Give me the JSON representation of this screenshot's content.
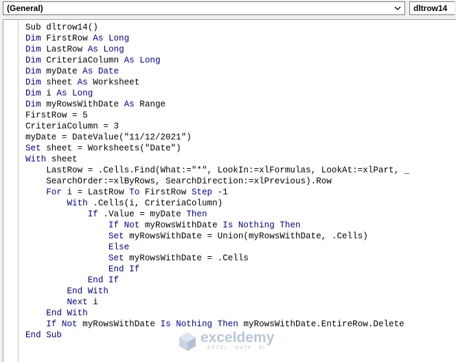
{
  "toolbar": {
    "object_box": "(General)",
    "procedure_box": "dltrow14"
  },
  "code_lines": [
    [
      {
        "t": "Sub dltrow14()",
        "k": false
      }
    ],
    [
      {
        "t": "Dim",
        "k": true
      },
      {
        "t": " FirstRow ",
        "k": false
      },
      {
        "t": "As Long",
        "k": true
      }
    ],
    [
      {
        "t": "Dim",
        "k": true
      },
      {
        "t": " LastRow ",
        "k": false
      },
      {
        "t": "As Long",
        "k": true
      }
    ],
    [
      {
        "t": "Dim",
        "k": true
      },
      {
        "t": " CriteriaColumn ",
        "k": false
      },
      {
        "t": "As Long",
        "k": true
      }
    ],
    [
      {
        "t": "Dim",
        "k": true
      },
      {
        "t": " myDate ",
        "k": false
      },
      {
        "t": "As Date",
        "k": true
      }
    ],
    [
      {
        "t": "Dim",
        "k": true
      },
      {
        "t": " sheet ",
        "k": false
      },
      {
        "t": "As",
        "k": true
      },
      {
        "t": " Worksheet",
        "k": false
      }
    ],
    [
      {
        "t": "Dim",
        "k": true
      },
      {
        "t": " i ",
        "k": false
      },
      {
        "t": "As Long",
        "k": true
      }
    ],
    [
      {
        "t": "Dim",
        "k": true
      },
      {
        "t": " myRowsWithDate ",
        "k": false
      },
      {
        "t": "As",
        "k": true
      },
      {
        "t": " Range",
        "k": false
      }
    ],
    [
      {
        "t": "FirstRow = 5",
        "k": false
      }
    ],
    [
      {
        "t": "CriteriaColumn = 3",
        "k": false
      }
    ],
    [
      {
        "t": "myDate = DateValue(\"11/12/2021\")",
        "k": false
      }
    ],
    [
      {
        "t": "Set",
        "k": true
      },
      {
        "t": " sheet = Worksheets(\"Date\")",
        "k": false
      }
    ],
    [
      {
        "t": "With",
        "k": true
      },
      {
        "t": " sheet",
        "k": false
      }
    ],
    [
      {
        "t": "    LastRow = .Cells.Find(What:=\"*\", LookIn:=xlFormulas, LookAt:=xlPart, _",
        "k": false
      }
    ],
    [
      {
        "t": "    SearchOrder:=xlByRows, SearchDirection:=xlPrevious).Row",
        "k": false
      }
    ],
    [
      {
        "t": "    ",
        "k": false
      },
      {
        "t": "For",
        "k": true
      },
      {
        "t": " i = LastRow ",
        "k": false
      },
      {
        "t": "To",
        "k": true
      },
      {
        "t": " FirstRow ",
        "k": false
      },
      {
        "t": "Step",
        "k": true
      },
      {
        "t": " -1",
        "k": false
      }
    ],
    [
      {
        "t": "        ",
        "k": false
      },
      {
        "t": "With",
        "k": true
      },
      {
        "t": " .Cells(i, CriteriaColumn)",
        "k": false
      }
    ],
    [
      {
        "t": "            ",
        "k": false
      },
      {
        "t": "If",
        "k": true
      },
      {
        "t": " .Value = myDate ",
        "k": false
      },
      {
        "t": "Then",
        "k": true
      }
    ],
    [
      {
        "t": "                ",
        "k": false
      },
      {
        "t": "If Not",
        "k": true
      },
      {
        "t": " myRowsWithDate ",
        "k": false
      },
      {
        "t": "Is Nothing Then",
        "k": true
      }
    ],
    [
      {
        "t": "                ",
        "k": false
      },
      {
        "t": "Set",
        "k": true
      },
      {
        "t": " myRowsWithDate = Union(myRowsWithDate, .Cells)",
        "k": false
      }
    ],
    [
      {
        "t": "                ",
        "k": false
      },
      {
        "t": "Else",
        "k": true
      }
    ],
    [
      {
        "t": "                ",
        "k": false
      },
      {
        "t": "Set",
        "k": true
      },
      {
        "t": " myRowsWithDate = .Cells",
        "k": false
      }
    ],
    [
      {
        "t": "                ",
        "k": false
      },
      {
        "t": "End If",
        "k": true
      }
    ],
    [
      {
        "t": "            ",
        "k": false
      },
      {
        "t": "End If",
        "k": true
      }
    ],
    [
      {
        "t": "        ",
        "k": false
      },
      {
        "t": "End With",
        "k": true
      }
    ],
    [
      {
        "t": "        ",
        "k": false
      },
      {
        "t": "Next",
        "k": true
      },
      {
        "t": " i",
        "k": false
      }
    ],
    [
      {
        "t": "    ",
        "k": false
      },
      {
        "t": "End With",
        "k": true
      }
    ],
    [
      {
        "t": "    ",
        "k": false
      },
      {
        "t": "If Not",
        "k": true
      },
      {
        "t": " myRowsWithDate ",
        "k": false
      },
      {
        "t": "Is Nothing Then",
        "k": true
      },
      {
        "t": " myRowsWithDate.EntireRow.Delete",
        "k": false
      }
    ],
    [
      {
        "t": "End Sub",
        "k": true
      }
    ]
  ],
  "watermark": {
    "name": "exceldemy",
    "tagline": "EXCEL · DATA · BI"
  },
  "colors": {
    "keyword": "#00008b",
    "text": "#000000"
  },
  "icons": {
    "dropdown": "chevron-down-icon",
    "logo": "exceldemy-logo-icon"
  }
}
